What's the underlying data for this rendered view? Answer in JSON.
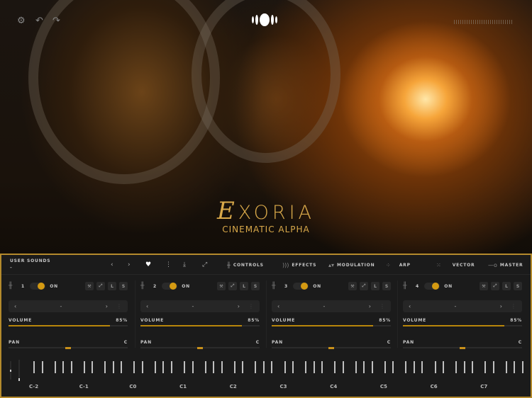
{
  "hero": {
    "brand_initial": "E",
    "brand_rest": "XORIA",
    "subtitle": "CINEMATIC ALPHA"
  },
  "header": {
    "user_sounds_label": "USER SOUNDS",
    "preset_name": "-",
    "tabs": [
      {
        "label": "CONTROLS",
        "icon": "waveform-icon"
      },
      {
        "label": "EFFECTS",
        "icon": "effects-icon"
      },
      {
        "label": "MODULATION",
        "icon": "modulation-icon"
      },
      {
        "label": "ARP",
        "icon": "arp-icon"
      },
      {
        "label": "VECTOR",
        "icon": "vector-icon"
      },
      {
        "label": "MASTER",
        "icon": "master-icon"
      }
    ]
  },
  "channels": [
    {
      "number": "1",
      "toggle": "ON",
      "on": true,
      "sound": "-",
      "volume_label": "VOLUME",
      "volume_text": "85%",
      "volume": 0.85,
      "pan_label": "PAN",
      "pan_text": "C",
      "pan": 0.5
    },
    {
      "number": "2",
      "toggle": "ON",
      "on": true,
      "sound": "-",
      "volume_label": "VOLUME",
      "volume_text": "85%",
      "volume": 0.85,
      "pan_label": "PAN",
      "pan_text": "C",
      "pan": 0.5
    },
    {
      "number": "3",
      "toggle": "ON",
      "on": true,
      "sound": "-",
      "volume_label": "VOLUME",
      "volume_text": "85%",
      "volume": 0.85,
      "pan_label": "PAN",
      "pan_text": "C",
      "pan": 0.5
    },
    {
      "number": "4",
      "toggle": "ON",
      "on": true,
      "sound": "-",
      "volume_label": "VOLUME",
      "volume_text": "85%",
      "volume": 0.85,
      "pan_label": "PAN",
      "pan_text": "C",
      "pan": 0.5
    }
  ],
  "channel_buttons": {
    "l": "L",
    "s": "S"
  },
  "keyboard": {
    "octaves": [
      "C-2",
      "C-1",
      "C0",
      "C1",
      "C2",
      "C3",
      "C4",
      "C5",
      "C6",
      "C7"
    ]
  },
  "colors": {
    "accent": "#d49a12",
    "border": "#b48a2c"
  }
}
